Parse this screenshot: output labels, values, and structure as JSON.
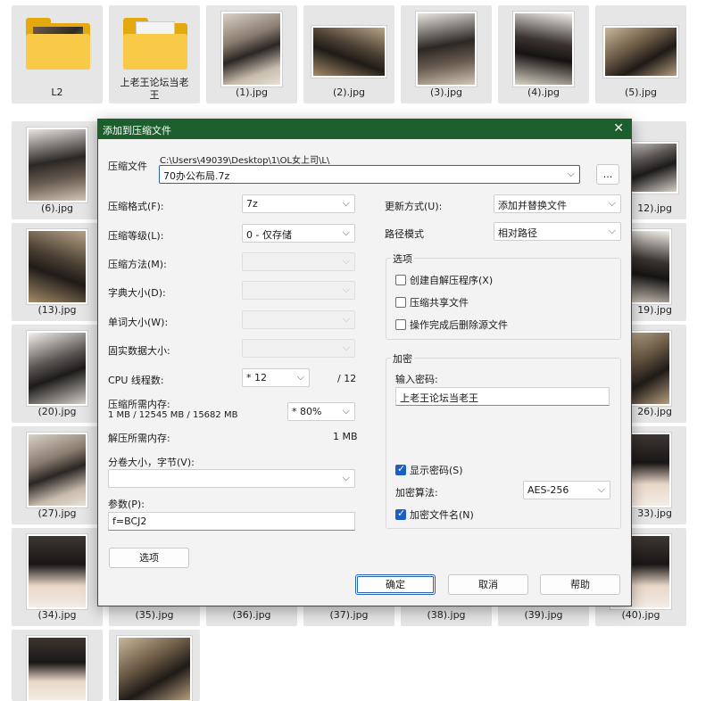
{
  "explorer": {
    "tiles": [
      {
        "name": "L2",
        "kind": "folder"
      },
      {
        "name": "上老王论坛当老王",
        "kind": "folder"
      },
      {
        "name": "(1).jpg"
      },
      {
        "name": "(2).jpg"
      },
      {
        "name": "(3).jpg"
      },
      {
        "name": "(4).jpg"
      },
      {
        "name": "(5).jpg"
      },
      {
        "name": "(6).jpg"
      },
      {
        "name": "12).jpg"
      },
      {
        "name": "(13).jpg"
      },
      {
        "name": "19).jpg"
      },
      {
        "name": "(20).jpg"
      },
      {
        "name": "26).jpg"
      },
      {
        "name": "(27).jpg"
      },
      {
        "name": "33).jpg"
      },
      {
        "name": "(34).jpg"
      },
      {
        "name": "(35).jpg"
      },
      {
        "name": "(36).jpg"
      },
      {
        "name": "(37).jpg"
      },
      {
        "name": "(38).jpg"
      },
      {
        "name": "(39).jpg"
      },
      {
        "name": "(40).jpg"
      }
    ]
  },
  "dialog": {
    "title": "添加到压缩文件",
    "close_icon": "✕",
    "archive_label": "压缩文件",
    "archive_path": "C:\\Users\\49039\\Desktop\\1\\OL女上司\\L\\",
    "archive_name": "70办公布局.7z",
    "browse_label": "...",
    "format_label": "压缩格式(F):",
    "format_value": "7z",
    "level_label": "压缩等级(L):",
    "level_value": "0 - 仅存储",
    "method_label": "压缩方法(M):",
    "dict_label": "字典大小(D):",
    "word_label": "单词大小(W):",
    "solid_label": "固实数据大小:",
    "cpu_label": "CPU 线程数:",
    "cpu_value": "* 12",
    "cpu_max": "/ 12",
    "mem_label": "压缩所需内存:",
    "mem_detail": "1 MB / 12545 MB / 15682 MB",
    "mem_value": "* 80%",
    "decomp_label": "解压所需内存:",
    "decomp_value": "1 MB",
    "volume_label": "分卷大小，字节(V):",
    "volume_value": "",
    "params_label": "参数(P):",
    "params_value": "f=BCJ2",
    "options_button": "选项",
    "update_label": "更新方式(U):",
    "update_value": "添加并替换文件",
    "pathmode_label": "路径模式",
    "pathmode_value": "相对路径",
    "options_group": "选项",
    "opt_sfx": "创建自解压程序(X)",
    "opt_shared": "压缩共享文件",
    "opt_delete": "操作完成后删除源文件",
    "encrypt_group": "加密",
    "password_label": "输入密码:",
    "password_value": "上老王论坛当老王",
    "show_password": "显示密码(S)",
    "enc_method_label": "加密算法:",
    "enc_method_value": "AES-256",
    "enc_names": "加密文件名(N)",
    "ok_button": "确定",
    "cancel_button": "取消",
    "help_button": "帮助",
    "dropdown_icon": "⌵"
  }
}
